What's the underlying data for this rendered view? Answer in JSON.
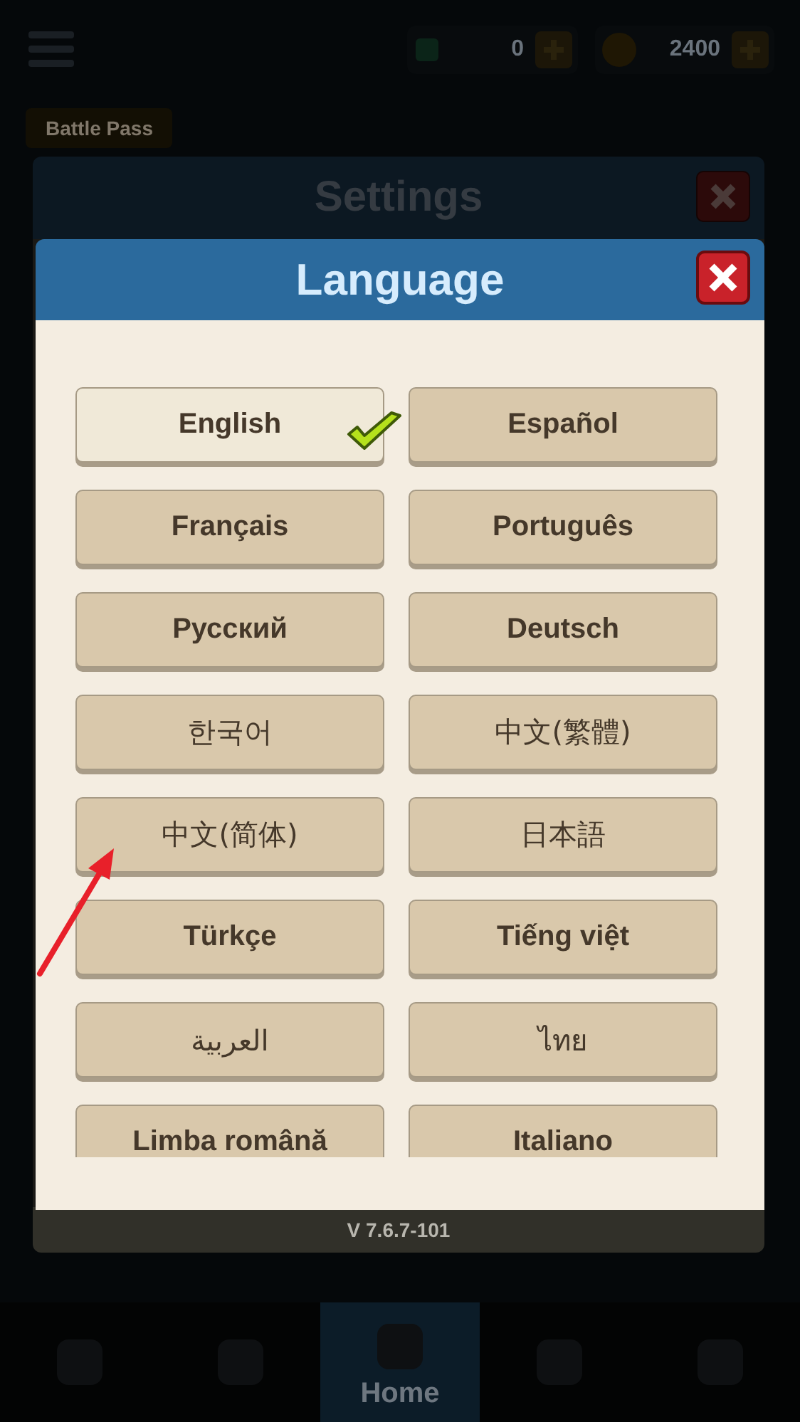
{
  "top_bar": {
    "gems": "0",
    "coins": "2400"
  },
  "battle_pass": {
    "label": "Battle Pass"
  },
  "settings": {
    "title": "Settings",
    "version": "V 7.6.7-101"
  },
  "language_dialog": {
    "title": "Language",
    "languages": [
      {
        "label": "English",
        "kind": "latin",
        "selected": true
      },
      {
        "label": "Español",
        "kind": "latin",
        "selected": false
      },
      {
        "label": "Français",
        "kind": "latin",
        "selected": false
      },
      {
        "label": "Português",
        "kind": "latin",
        "selected": false
      },
      {
        "label": "Русский",
        "kind": "latin",
        "selected": false
      },
      {
        "label": "Deutsch",
        "kind": "latin",
        "selected": false
      },
      {
        "label": "한국어",
        "kind": "native",
        "selected": false
      },
      {
        "label": "中文(繁體)",
        "kind": "native",
        "selected": false
      },
      {
        "label": "中文(简体)",
        "kind": "native",
        "selected": false
      },
      {
        "label": "日本語",
        "kind": "native",
        "selected": false
      },
      {
        "label": "Türkçe",
        "kind": "latin",
        "selected": false
      },
      {
        "label": "Tiếng việt",
        "kind": "latin",
        "selected": false
      },
      {
        "label": "العربية",
        "kind": "native",
        "selected": false
      },
      {
        "label": "ไทย",
        "kind": "native",
        "selected": false
      },
      {
        "label": "Limba română",
        "kind": "latin",
        "selected": false
      },
      {
        "label": "Italiano",
        "kind": "latin",
        "selected": false
      }
    ]
  },
  "bottom_nav": [
    {
      "selected": false
    },
    {
      "selected": false
    },
    {
      "label": "Home",
      "selected": true
    },
    {
      "selected": false
    },
    {
      "selected": false
    }
  ]
}
